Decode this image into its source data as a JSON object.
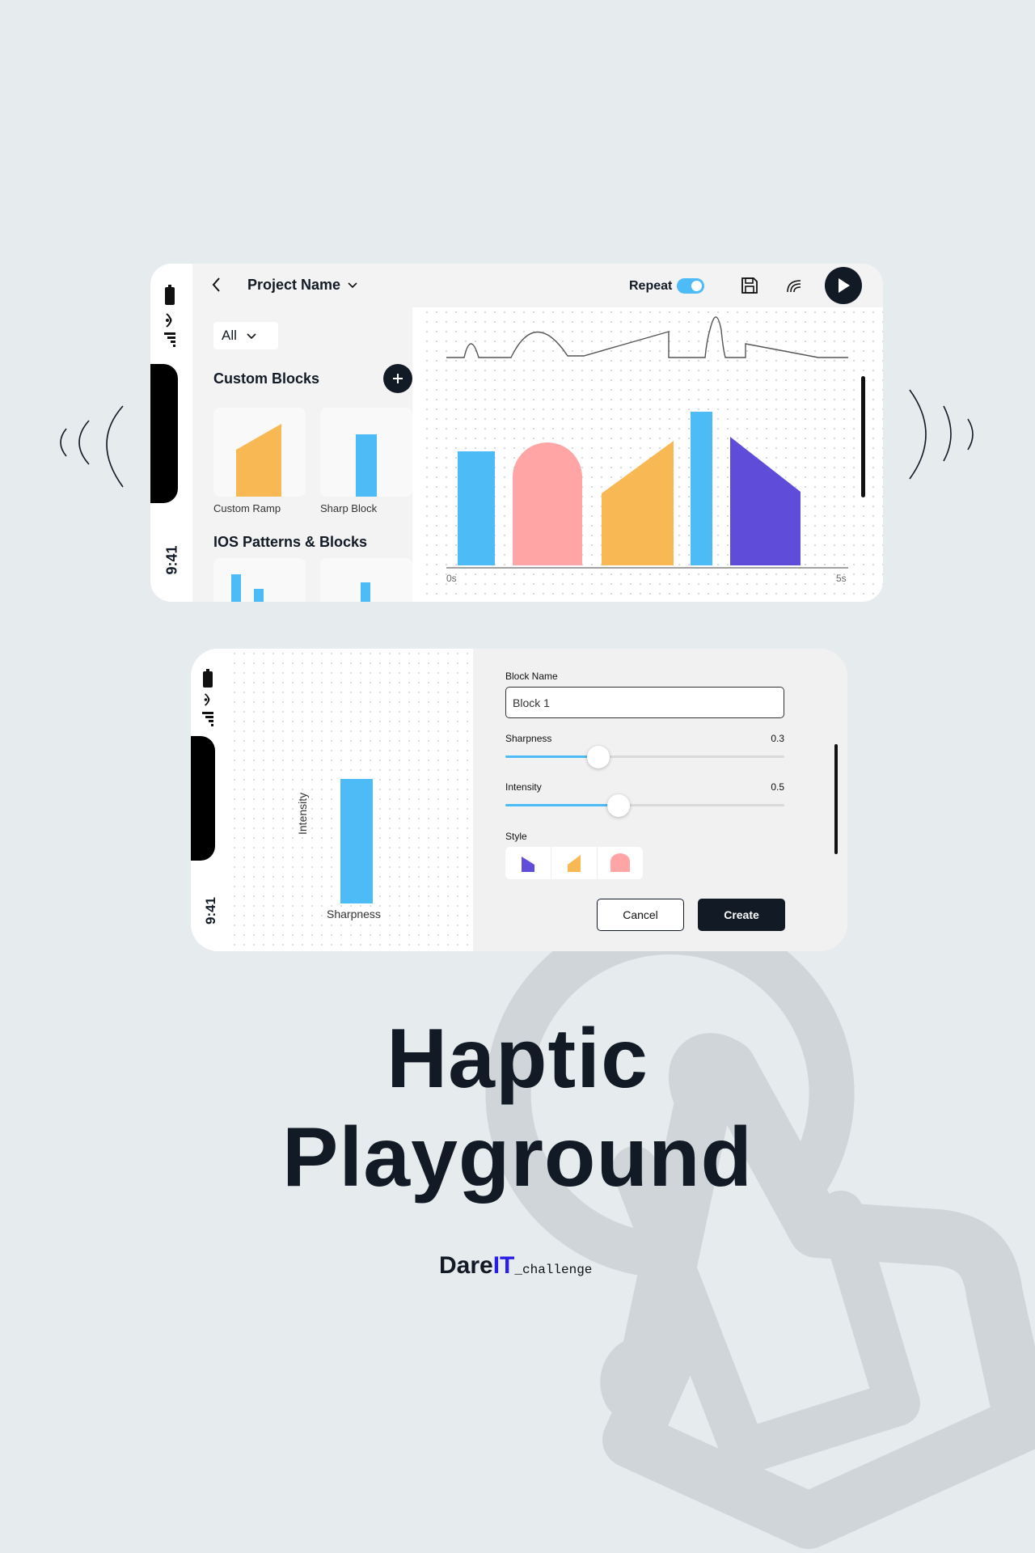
{
  "project": {
    "name": "Project Name"
  },
  "toolbar": {
    "repeat_label": "Repeat",
    "repeat_on": true
  },
  "status": {
    "time": "9:41"
  },
  "sidebar": {
    "filter": "All",
    "custom_blocks_title": "Custom Blocks",
    "custom_blocks": [
      {
        "label": "Custom Ramp",
        "icon": "ramp-shape",
        "color": "#f8b955"
      },
      {
        "label": "Sharp Block",
        "icon": "bar-shape",
        "color": "#4dbbf5"
      }
    ],
    "ios_title": "IOS Patterns & Blocks"
  },
  "timeline": {
    "start_label": "0s",
    "end_label": "5s",
    "blocks": [
      {
        "shape": "rect",
        "color": "#4dbbf5"
      },
      {
        "shape": "arch",
        "color": "#ffa5a5"
      },
      {
        "shape": "ramp",
        "color": "#f8b955"
      },
      {
        "shape": "rect",
        "color": "#4dbbf5"
      },
      {
        "shape": "drop",
        "color": "#5f4cd8"
      }
    ]
  },
  "editor": {
    "block_name_label": "Block Name",
    "block_name_value": "Block 1",
    "sharpness_label": "Sharpness",
    "sharpness_value": "0.3",
    "intensity_label": "Intensity",
    "intensity_value": "0.5",
    "style_label": "Style",
    "styles": [
      {
        "name": "drop-style-icon",
        "color": "#5f4cd8"
      },
      {
        "name": "ramp-style-icon",
        "color": "#f8b955"
      },
      {
        "name": "arch-style-icon",
        "color": "#ffa5a5"
      }
    ],
    "preview_x_label": "Sharpness",
    "preview_y_label": "Intensity",
    "cancel_label": "Cancel",
    "create_label": "Create"
  },
  "hero": {
    "line1": "Haptic",
    "line2": "Playground"
  },
  "brand": {
    "dare": "Dare",
    "it": "IT",
    "suffix": "_challenge"
  },
  "colors": {
    "accent": "#4dbbf5",
    "dark": "#111a25",
    "brand_blue": "#2a1ee8",
    "background": "#e6ebee"
  }
}
